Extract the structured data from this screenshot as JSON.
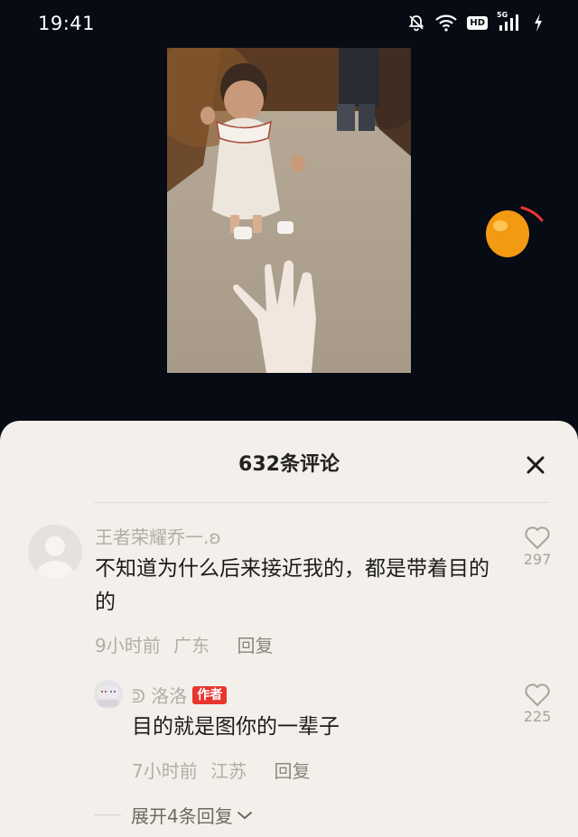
{
  "status_bar": {
    "time": "19:41",
    "hd_label": "HD",
    "network_label": "5G"
  },
  "comments_panel": {
    "title": "632条评论",
    "comments": [
      {
        "username": "王者荣耀乔一.ʚ",
        "text": "不知道为什么后来接近我的，都是带着目的的",
        "time": "9小时前",
        "location": "广东",
        "reply_label": "回复",
        "like_count": "297"
      }
    ],
    "replies": [
      {
        "username": "ᕲ 洛洛",
        "badge": "作者",
        "text": "目的就是图你的一辈子",
        "time": "7小时前",
        "location": "江苏",
        "reply_label": "回复",
        "like_count": "225"
      }
    ],
    "expand_label": "展开4条回复"
  },
  "colors": {
    "sheet_bg": "#f3efeb",
    "author_badge": "#e8362f",
    "page_bg": "#070b14"
  }
}
